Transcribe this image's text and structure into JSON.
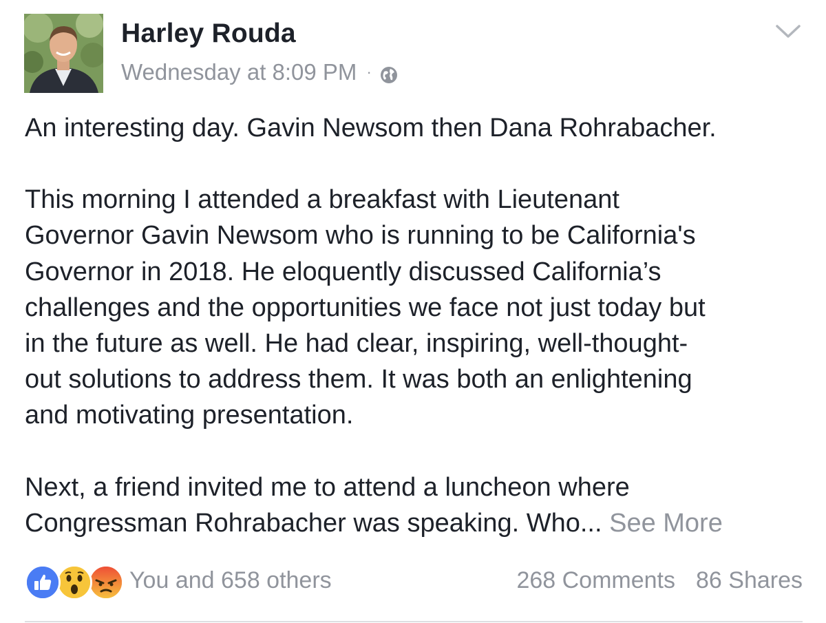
{
  "post": {
    "author": "Harley Rouda",
    "timestamp": "Wednesday at 8:09 PM",
    "separator": "·",
    "privacy_icon": "globe-icon",
    "menu_icon": "chevron-down-icon",
    "paragraphs": [
      "An interesting day. Gavin Newsom then Dana Rohrabacher.",
      "This morning I attended a breakfast with Lieutenant\nGovernor Gavin Newsom who is running to be California's\nGovernor in 2018. He eloquently discussed California’s\nchallenges and the opportunities we face not just today but\nin the future as well. He had clear, inspiring, well-thought-\nout solutions to address them. It was both an enlightening\nand motivating presentation.",
      "Next, a friend invited me to attend a luncheon where\nCongressman Rohrabacher was speaking. Who..."
    ],
    "see_more": "See More"
  },
  "footer": {
    "reactions": [
      "like-icon",
      "wow-icon",
      "angry-icon"
    ],
    "reaction_text": "You and 658 others",
    "comments": "268 Comments",
    "shares": "86 Shares"
  },
  "colors": {
    "text": "#1d2129",
    "muted": "#90949c",
    "like": "#4a7cf4",
    "divider": "#dddfe2"
  }
}
